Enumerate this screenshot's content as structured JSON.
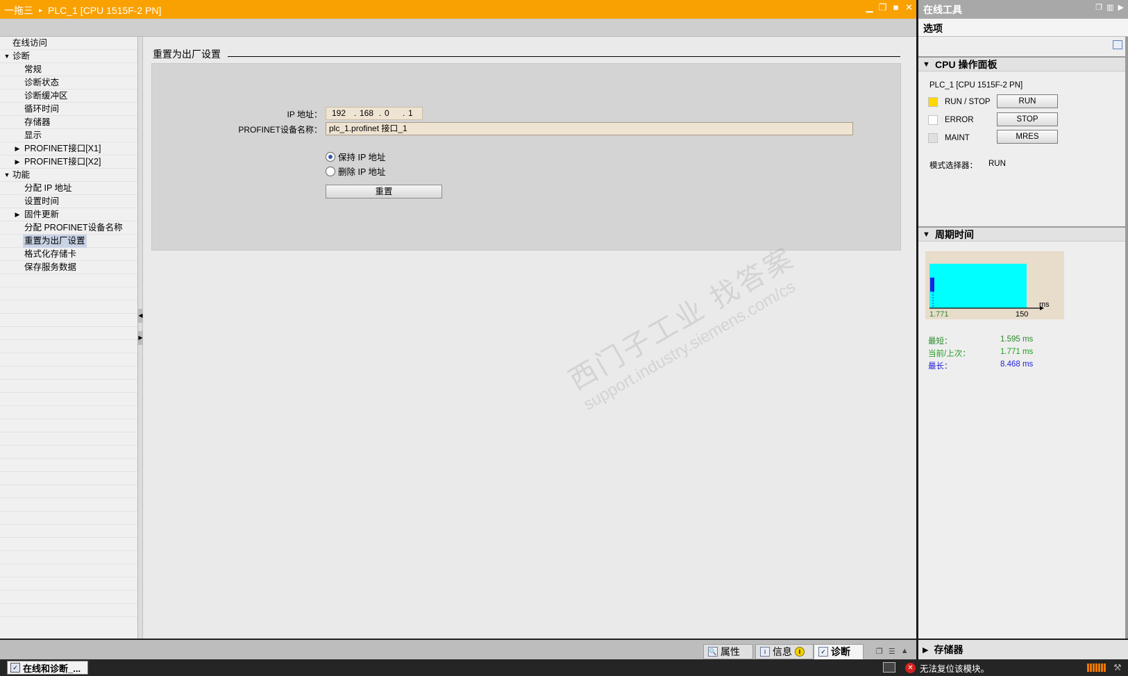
{
  "editor": {
    "breadcrumb": [
      "一拖三",
      "PLC_1 [CPU 1515F-2 PN]"
    ],
    "breadcrumb_sep": "▸",
    "window_controls": [
      "▁",
      "❐",
      "■",
      "✕"
    ]
  },
  "tree": {
    "items": [
      {
        "label": "在线访问",
        "level": 0,
        "toggle": ""
      },
      {
        "label": "诊断",
        "level": 0,
        "toggle": "▼"
      },
      {
        "label": "常规",
        "level": 1,
        "toggle": ""
      },
      {
        "label": "诊断状态",
        "level": 1,
        "toggle": ""
      },
      {
        "label": "诊断缓冲区",
        "level": 1,
        "toggle": ""
      },
      {
        "label": "循环时间",
        "level": 1,
        "toggle": ""
      },
      {
        "label": "存储器",
        "level": 1,
        "toggle": ""
      },
      {
        "label": "显示",
        "level": 1,
        "toggle": ""
      },
      {
        "label": "PROFINET接口[X1]",
        "level": 1,
        "toggle": "▶"
      },
      {
        "label": "PROFINET接口[X2]",
        "level": 1,
        "toggle": "▶"
      },
      {
        "label": "功能",
        "level": 0,
        "toggle": "▼"
      },
      {
        "label": "分配 IP 地址",
        "level": 1,
        "toggle": ""
      },
      {
        "label": "设置时间",
        "level": 1,
        "toggle": ""
      },
      {
        "label": "固件更新",
        "level": 1,
        "toggle": "▶"
      },
      {
        "label": "分配 PROFINET设备名称",
        "level": 1,
        "toggle": ""
      },
      {
        "label": "重置为出厂设置",
        "level": 1,
        "toggle": "",
        "selected": true
      },
      {
        "label": "格式化存储卡",
        "level": 1,
        "toggle": ""
      },
      {
        "label": "保存服务数据",
        "level": 1,
        "toggle": ""
      }
    ],
    "empty_rows": 26
  },
  "content": {
    "section_title": "重置为出厂设置",
    "ip_label": "IP 地址：",
    "ip_octets": [
      "192",
      ".",
      "168",
      ".",
      "0",
      ".",
      "1"
    ],
    "profinet_label": "PROFINET设备名称：",
    "profinet_value": "plc_1.profinet 接口_1",
    "radio_keep": "保持 IP 地址",
    "radio_delete": "删除 IP 地址",
    "selected_radio": "keep",
    "reset_button": "重置"
  },
  "watermark": {
    "line1": "西门子工业  找答案",
    "line2": "support.industry.siemens.com/cs"
  },
  "bottom_tabs": {
    "properties": "属性",
    "info": "信息",
    "diagnostics": "诊断",
    "active": "diagnostics"
  },
  "online_tools": {
    "title": "在线工具",
    "options_label": "选项",
    "cpu_panel_title": "CPU 操作面板",
    "cpu_name": "PLC_1 [CPU 1515F-2 PN]",
    "leds": [
      {
        "label": "RUN / STOP",
        "color": "#ffd800",
        "button": "RUN"
      },
      {
        "label": "ERROR",
        "color": "#ffffff",
        "button": "STOP"
      },
      {
        "label": "MAINT",
        "color": "#e0e0e0",
        "button": "MRES"
      }
    ],
    "mode_selector_label": "模式选择器：",
    "mode_selector_value": "RUN",
    "cycle_time_title": "周期时间",
    "cycle_chart": {
      "x_unit": "ms",
      "x_min_label": "1.771",
      "x_max_label": "150",
      "range_color": "#00ffff",
      "marker_color": "#2222dd"
    },
    "stats": [
      {
        "label": "最短：",
        "value": "1.595 ms",
        "color": "#2a8a2a"
      },
      {
        "label": "当前/上次：",
        "value": "1.771 ms",
        "color": "#22a022"
      },
      {
        "label": "最长：",
        "value": "8.468 ms",
        "color": "#2222dd"
      }
    ],
    "memory_title": "存储器"
  },
  "statusbar": {
    "portal_button": "在线和诊断_...",
    "message": "无法复位该模块。"
  }
}
